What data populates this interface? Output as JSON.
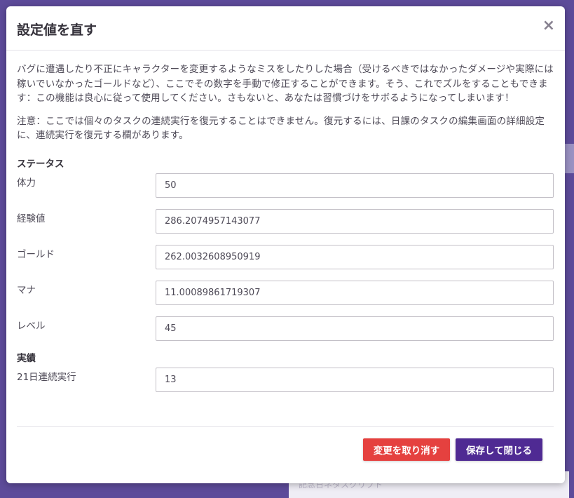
{
  "modal": {
    "title": "設定値を直す",
    "close_symbol": "×",
    "description": "バグに遭遇したり不正にキャラクターを変更するようなミスをしたりした場合（受けるべきではなかったダメージや実際には稼いでいなかったゴールドなど）、ここでその数字を手動で修正することができます。そう、これでズルをすることもできます：この機能は良心に従って使用してください。さもないと、あなたは習慣づけをサボるようになってしまいます！",
    "note": "注意：ここでは個々のタスクの連続実行を復元することはできません。復元するには、日課のタスクの編集画面の詳細設定に、連続実行を復元する欄があります。"
  },
  "stats": {
    "section_title": "ステータス",
    "health_label": "体力",
    "health_value": "50",
    "experience_label": "経験値",
    "experience_value": "286.2074957143077",
    "gold_label": "ゴールド",
    "gold_value": "262.0032608950919",
    "mana_label": "マナ",
    "mana_value": "11.00089861719307",
    "level_label": "レベル",
    "level_value": "45"
  },
  "achievements": {
    "section_title": "実績",
    "streak_label": "21日連続実行",
    "streak_value": "13"
  },
  "footer": {
    "cancel_label": "変更を取り消す",
    "save_label": "保存して閉じる"
  },
  "background": {
    "partial_text": "記念日ネタスクリプト"
  },
  "colors": {
    "cancel": "#e5413f",
    "save": "#4f2a93",
    "backdrop": "#5d4b9a"
  }
}
